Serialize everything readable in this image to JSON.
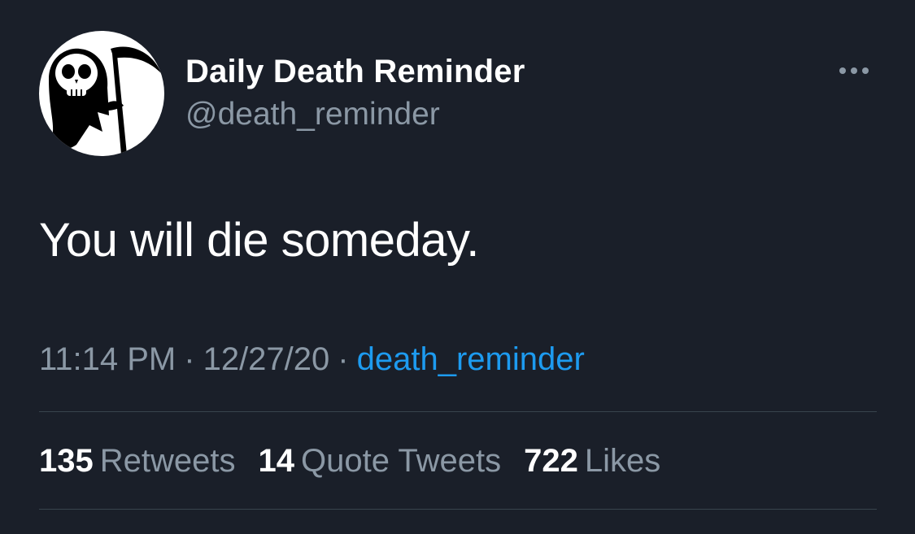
{
  "author": {
    "display_name": "Daily Death Reminder",
    "handle": "@death_reminder",
    "avatar_icon": "grim-reaper-icon"
  },
  "tweet": {
    "text": "You will die someday.",
    "time": "11:14 PM",
    "date": "12/27/20",
    "separator": "·",
    "source": "death_reminder"
  },
  "stats": {
    "retweets": {
      "count": "135",
      "label": "Retweets"
    },
    "quote_tweets": {
      "count": "14",
      "label": "Quote Tweets"
    },
    "likes": {
      "count": "722",
      "label": "Likes"
    }
  },
  "colors": {
    "background": "#1a1f29",
    "primary_text": "#ffffff",
    "secondary_text": "#8b98a5",
    "link": "#1d9bf0",
    "divider": "#38444d"
  }
}
